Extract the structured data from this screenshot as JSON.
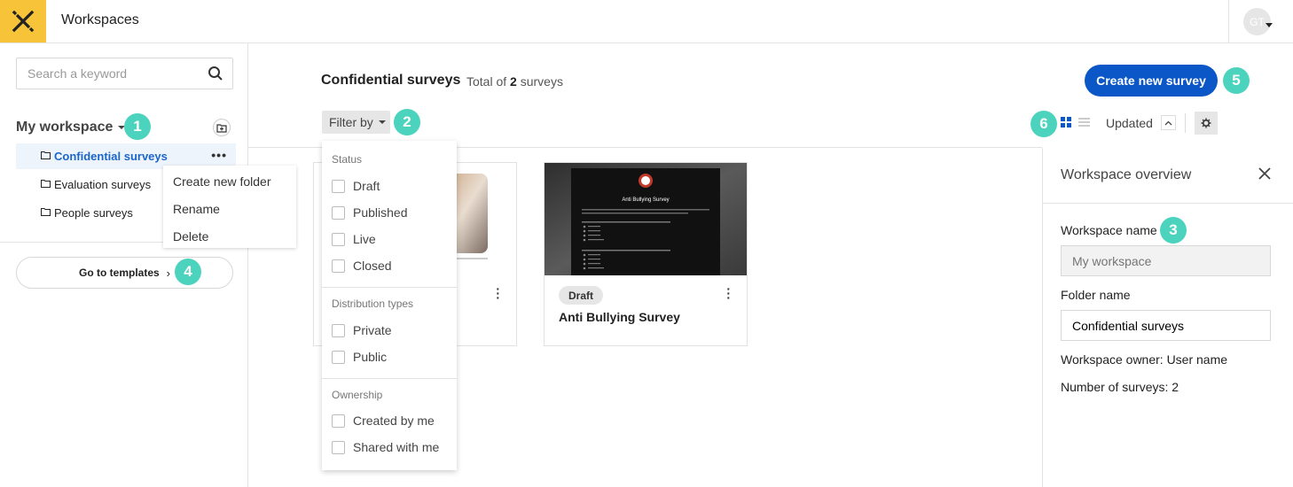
{
  "app": {
    "title": "Workspaces",
    "avatar_initials": "GT"
  },
  "sidebar": {
    "search_placeholder": "Search a keyword",
    "workspace_title": "My workspace",
    "folders": [
      {
        "label": "Confidential surveys",
        "active": true
      },
      {
        "label": "Evaluation surveys",
        "active": false
      },
      {
        "label": "People surveys",
        "active": false
      }
    ],
    "folder_menu": [
      "Create new folder",
      "Rename",
      "Delete"
    ],
    "templates_label": "Go to templates"
  },
  "main": {
    "title": "Confidential surveys",
    "total_prefix": "Total of",
    "total_count": "2",
    "total_suffix": "surveys",
    "filter_label": "Filter by",
    "create_label": "Create new survey",
    "sort_label": "Updated",
    "view_mode": "grid"
  },
  "filter_dropdown": {
    "sections": [
      {
        "title": "Status",
        "options": [
          "Draft",
          "Published",
          "Live",
          "Closed"
        ]
      },
      {
        "title": "Distribution types",
        "options": [
          "Private",
          "Public"
        ]
      },
      {
        "title": "Ownership",
        "options": [
          "Created by me",
          "Shared with me"
        ]
      }
    ]
  },
  "cards": [
    {
      "status": "",
      "title": ""
    },
    {
      "status": "Draft",
      "title": "Anti Bullying Survey",
      "thumb_heading": "Anti Bullying Survey"
    }
  ],
  "overview": {
    "title": "Workspace overview",
    "workspace_name_label": "Workspace name",
    "workspace_name_value": "My workspace",
    "folder_name_label": "Folder name",
    "folder_name_value": "Confidential surveys",
    "owner_line": "Workspace owner: User name",
    "count_line": "Number of surveys: 2"
  },
  "annotations": [
    "1",
    "2",
    "3",
    "4",
    "5",
    "6"
  ],
  "colors": {
    "accent": "#0b57c7",
    "logo": "#f7c339",
    "badge": "#4cd3be"
  }
}
